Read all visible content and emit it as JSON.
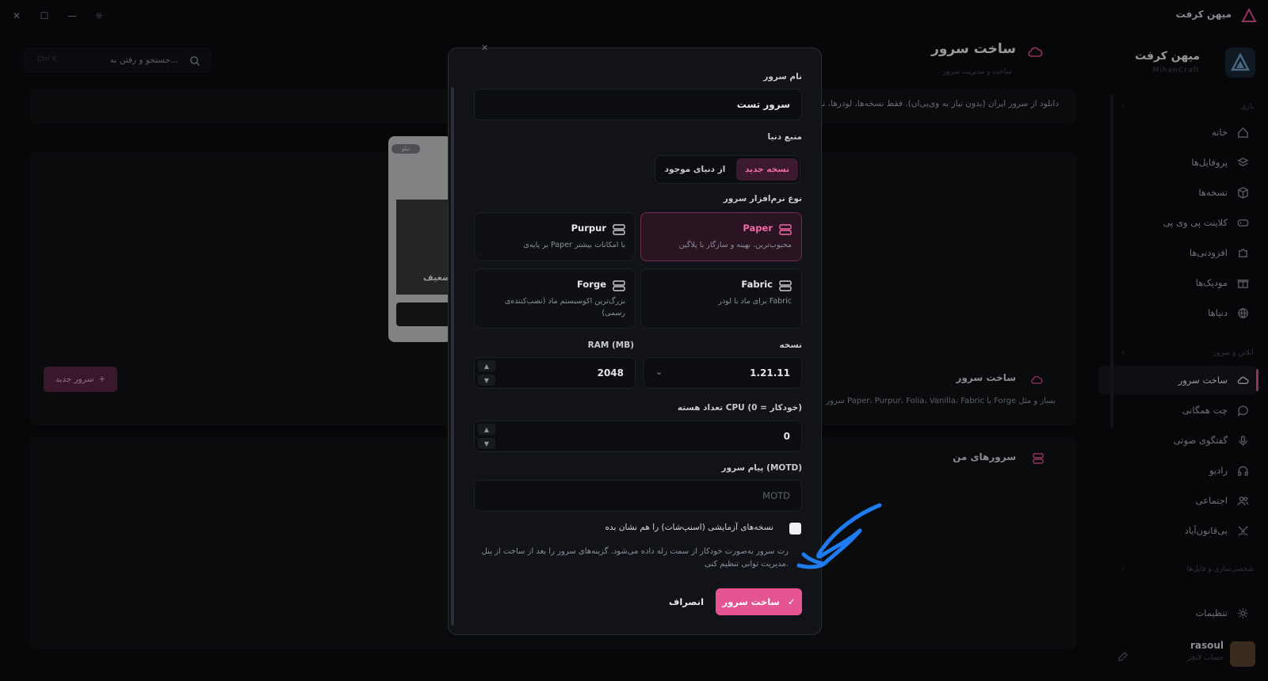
{
  "app": {
    "title": "میهن کرفت",
    "brand_name": "میهن کرفت",
    "brand_sub": "MihanCraft"
  },
  "search": {
    "placeholder": "جستجو و رفتن به...",
    "shortcut": "Ctrl K"
  },
  "page": {
    "title": "ساخت سرور",
    "subtitle": "ساخت و مدیریت سرور"
  },
  "info_banner": {
    "text": "دانلود از سرور ایران (بدون نیاز به وی‌پی‌ان). فقط نسخه‌ها، لودرها، نسخ"
  },
  "sidebar": {
    "section1": "بازی",
    "items1": [
      {
        "label": "خانه",
        "icon": "home-icon"
      },
      {
        "label": "پروفایل‌ها",
        "icon": "layers-icon"
      },
      {
        "label": "نسخه‌ها",
        "icon": "box-icon"
      },
      {
        "label": "کلاینت پی وی پی",
        "icon": "gamepad-icon"
      },
      {
        "label": "افزودنی‌ها",
        "icon": "puzzle-icon"
      },
      {
        "label": "مودپک‌ها",
        "icon": "gift-icon"
      },
      {
        "label": "دنیاها",
        "icon": "globe-icon"
      }
    ],
    "section2": "آنلاین و سرور",
    "items2": [
      {
        "label": "ساخت سرور",
        "icon": "cloud-icon",
        "active": true
      },
      {
        "label": "چت همگانی",
        "icon": "chat-icon"
      },
      {
        "label": "گفتگوی صوتی",
        "icon": "mic-icon"
      },
      {
        "label": "رادیو",
        "icon": "headphones-icon"
      },
      {
        "label": "اجتماعی",
        "icon": "users-icon"
      },
      {
        "label": "بی‌قانون‌آباد",
        "icon": "swords-icon"
      }
    ],
    "section3": "شخصی‌سازی و فایل‌ها",
    "settings": "تنظیمات",
    "user": {
      "name": "rasoul",
      "sub": "حساب لانچر"
    }
  },
  "server_section": {
    "title": "ساخت سرور",
    "desc": "سرور Paper، Purpur، Folia، Vanilla، Fabric یا Forge بساز و مثل",
    "new_button": "سرور جدید"
  },
  "my_servers": {
    "title": "سرورهای من"
  },
  "bg_card": {
    "badge": "نبلو",
    "label": "ضعیف"
  },
  "modal": {
    "server_name_label": "نام سرور",
    "server_name_value": "سرور تست",
    "world_source_label": "منبع دنیا",
    "world_new": "نسخه جدید",
    "world_existing": "از دنیای موجود",
    "software_label": "نوع نرم‌افزار سرور",
    "software": [
      {
        "name": "Paper",
        "desc": "محبوب‌ترین، بهینه و سازگار با پلاگین",
        "active": true
      },
      {
        "name": "Purpur",
        "desc": "بر پایه‌ی Paper با امکانات بیشتر",
        "active": false
      },
      {
        "name": "Fabric",
        "desc": "برای ماد با لودر Fabric",
        "active": false
      },
      {
        "name": "Forge",
        "desc": "بزرگ‌ترین اکوسیستم ماد (نصب‌کننده‌ی رسمی)",
        "active": false
      }
    ],
    "version_label": "نسخه",
    "version_value": "1.21.11",
    "ram_label": "RAM (MB)",
    "ram_value": "2048",
    "cpu_label": "تعداد هسته CPU (0 = خودکار)",
    "cpu_value": "0",
    "motd_label": "پیام سرور (MOTD)",
    "motd_placeholder": "MOTD",
    "snapshot_label": "نسخه‌های آزمایشی (اسنپ‌شات) را هم نشان بده",
    "note": "رت سرور به‌صورت خودکار از سمت رله داده می‌شود. گزینه‌های سرور را بعد از ساخت از پنل مدیریت توانی تنظیم کنی.",
    "create_button": "ساخت سرور",
    "cancel_button": "انصراف"
  },
  "colors": {
    "accent": "#e45591",
    "annotation": "#1f7bf0"
  }
}
